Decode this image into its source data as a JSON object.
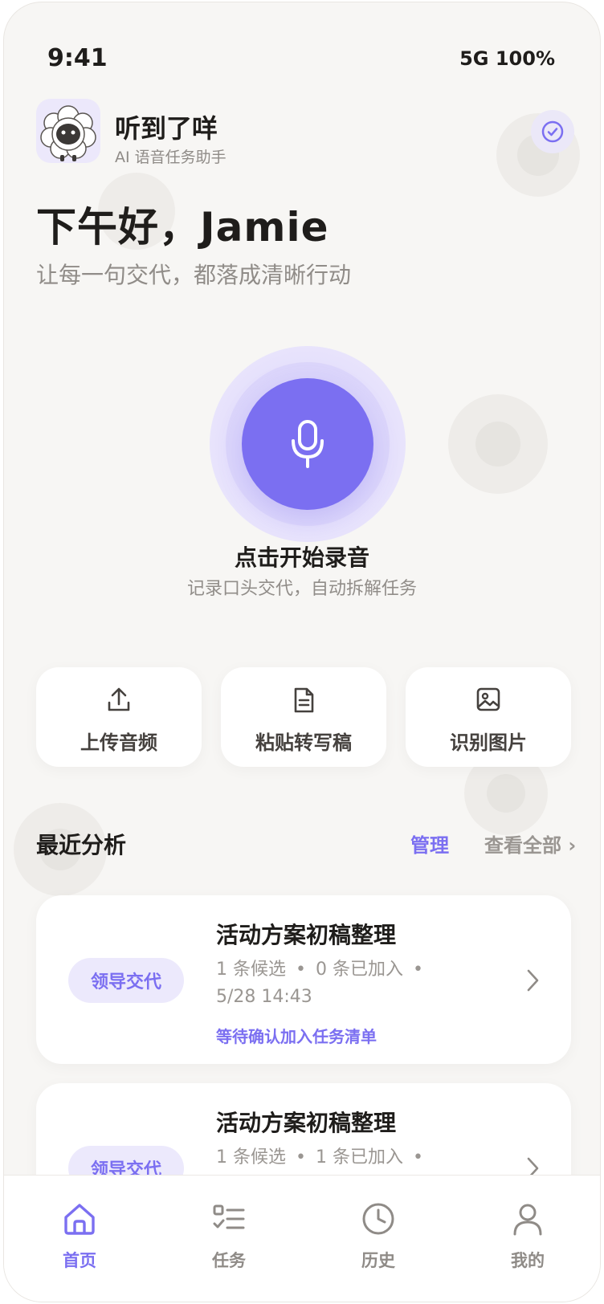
{
  "status_bar": {
    "time": "9:41",
    "network_battery": "5G 100%"
  },
  "app": {
    "name": "听到了咩",
    "subtitle": "AI 语音任务助手"
  },
  "greeting": {
    "title": "下午好，Jamie",
    "subtitle": "让每一句交代，都落成清晰行动"
  },
  "record": {
    "title": "点击开始录音",
    "subtitle": "记录口头交代，自动拆解任务"
  },
  "quick_actions": [
    {
      "label": "上传音频",
      "icon": "upload-icon"
    },
    {
      "label": "粘贴转写稿",
      "icon": "document-icon"
    },
    {
      "label": "识别图片",
      "icon": "image-icon"
    }
  ],
  "recent": {
    "title": "最近分析",
    "manage": "管理",
    "view_all": "查看全部 ›",
    "items": [
      {
        "tag": "领导交代",
        "title": "活动方案初稿整理",
        "candidates": "1 条候选",
        "added": "0 条已加入",
        "time": "5/28 14:43",
        "hint": "等待确认加入任务清单"
      },
      {
        "tag": "领导交代",
        "title": "活动方案初稿整理",
        "candidates": "1 条候选",
        "added": "1 条已加入",
        "time": "",
        "hint": ""
      }
    ]
  },
  "tabs": [
    {
      "label": "首页",
      "icon": "home-icon",
      "active": true
    },
    {
      "label": "任务",
      "icon": "task-list-icon",
      "active": false
    },
    {
      "label": "历史",
      "icon": "clock-icon",
      "active": false
    },
    {
      "label": "我的",
      "icon": "user-icon",
      "active": false
    }
  ],
  "colors": {
    "accent": "#7b6ff1",
    "accent_light": "#ece9fc",
    "background": "#f7f6f4",
    "text": "#1f1d1b",
    "muted": "#9a9692"
  }
}
